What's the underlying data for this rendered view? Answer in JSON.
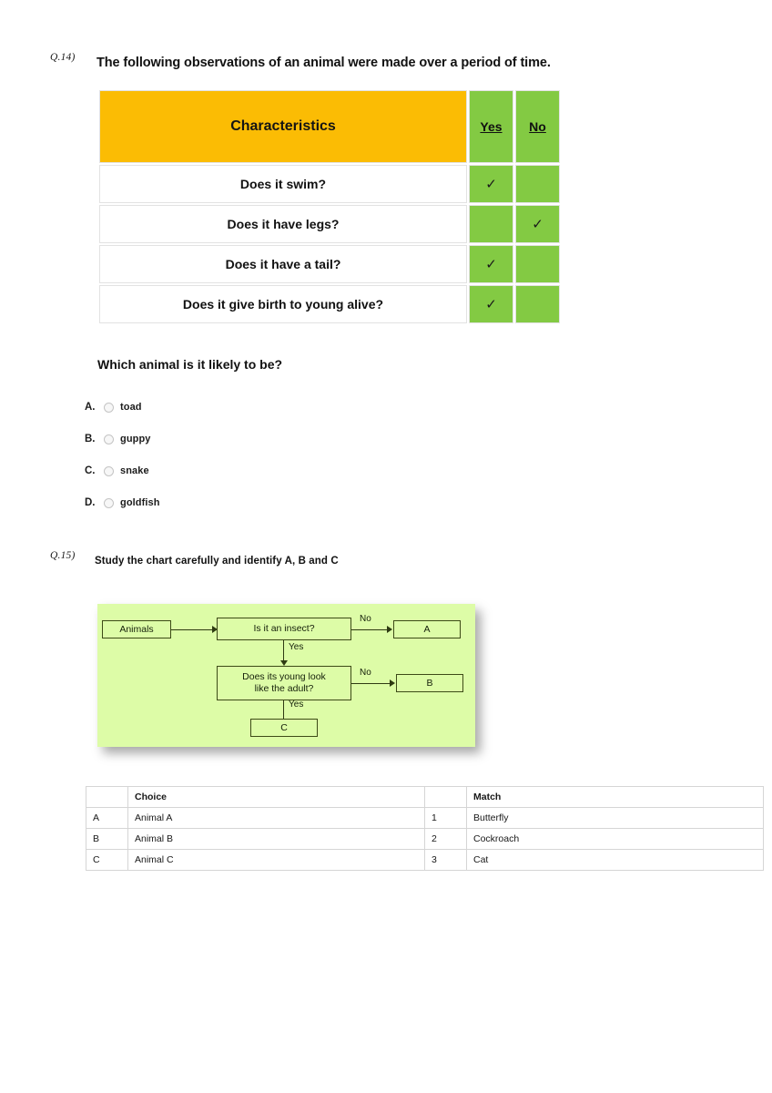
{
  "page": {
    "background": "#ffffff",
    "accent_orange": "#fbbc04",
    "accent_green": "#83ca43",
    "flow_green": "#ddfca7"
  },
  "q14": {
    "number": "Q.14)",
    "stem": "The following observations of an animal were made over a period of time.",
    "table": {
      "headers": [
        "Characteristics",
        "Yes",
        "No"
      ],
      "rows": [
        {
          "characteristic": "Does it swim?",
          "yes": "✓",
          "no": ""
        },
        {
          "characteristic": "Does it have legs?",
          "yes": "",
          "no": "✓"
        },
        {
          "characteristic": "Does it have a tail?",
          "yes": "✓",
          "no": ""
        },
        {
          "characteristic": "Does it give birth to young alive?",
          "yes": "✓",
          "no": ""
        }
      ]
    },
    "sub_question": "Which animal is it likely to be?",
    "options": [
      {
        "letter": "A.",
        "text": "toad",
        "selected": false
      },
      {
        "letter": "B.",
        "text": "guppy",
        "selected": false
      },
      {
        "letter": "C.",
        "text": "snake",
        "selected": false
      },
      {
        "letter": "D.",
        "text": "goldfish",
        "selected": false
      }
    ]
  },
  "q15": {
    "number": "Q.15)",
    "stem": "Study the chart carefully and identify A, B and C",
    "flowchart": {
      "nodes": {
        "start": "Animals",
        "decision1": "Is it an insect?",
        "decision2_line1": "Does its young look",
        "decision2_line2": "like the adult?",
        "outcome_a": "A",
        "outcome_b": "B",
        "outcome_c": "C"
      },
      "edge_labels": {
        "d1_no": "No",
        "d1_yes": "Yes",
        "d2_no": "No",
        "d2_yes": "Yes"
      }
    },
    "match_table": {
      "headers": [
        "",
        "Choice",
        "",
        "Match"
      ],
      "rows": [
        {
          "key": "A",
          "choice": "Animal A",
          "num": "1",
          "match": "Butterfly"
        },
        {
          "key": "B",
          "choice": "Animal B",
          "num": "2",
          "match": "Cockroach"
        },
        {
          "key": "C",
          "choice": "Animal C",
          "num": "3",
          "match": "Cat"
        }
      ]
    }
  }
}
